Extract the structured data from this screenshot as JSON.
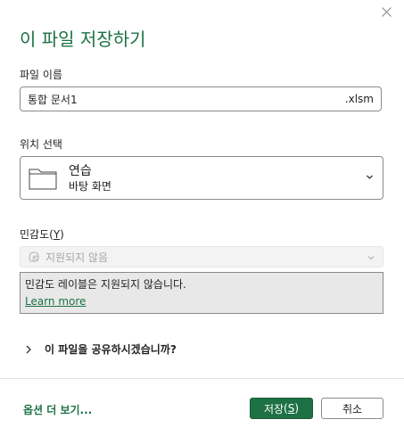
{
  "dialog": {
    "title": "이 파일 저장하기",
    "close_icon": "close-icon"
  },
  "filename": {
    "label": "파일 이름",
    "value": "통합 문서1",
    "extension": ".xlsm"
  },
  "location": {
    "label": "위치 선택",
    "name": "연습",
    "path": "바탕 화면",
    "icon": "folder-icon"
  },
  "sensitivity": {
    "label": "민감도",
    "access_key": "Y",
    "dropdown_text": "지원되지 않음",
    "notice": "민감도 레이블은 지원되지 않습니다.",
    "learn_more": "Learn more"
  },
  "share": {
    "label": "이 파일을 공유하시겠습니까?"
  },
  "footer": {
    "more_options": "옵션 더 보기...",
    "save_label": "저장",
    "save_access_key": "S",
    "cancel_label": "취소"
  },
  "colors": {
    "accent": "#1e7145",
    "border": "#8a8a8a",
    "disabled_bg": "#f3f3f3",
    "notice_bg": "#e8e8e8"
  }
}
